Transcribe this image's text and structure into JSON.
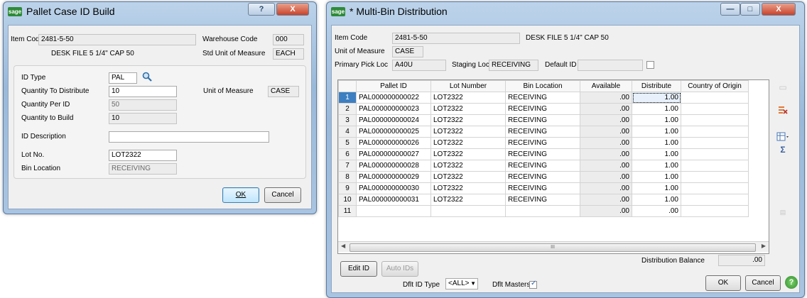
{
  "dialog1": {
    "logo": "sage",
    "title": "Pallet Case ID Build",
    "help_glyph": "?",
    "close_glyph": "X",
    "item_code_label": "Item Code",
    "item_code": "2481-5-50",
    "item_description": "DESK FILE 5 1/4\" CAP 50",
    "warehouse_code_label": "Warehouse Code",
    "warehouse_code": "000",
    "std_uom_label": "Std Unit of Measure",
    "std_uom": "EACH",
    "id_type_label": "ID Type",
    "id_type": "PAL",
    "qty_distribute_label": "Quantity To Distribute",
    "qty_distribute": "10",
    "uom_label": "Unit of Measure",
    "uom": "CASE",
    "qty_per_id_label": "Quantity Per ID",
    "qty_per_id": "50",
    "qty_build_label": "Quantity to Build",
    "qty_build": "10",
    "id_description_label": "ID Description",
    "id_description": "",
    "lot_no_label": "Lot No.",
    "lot_no": "LOT2322",
    "bin_location_label": "Bin Location",
    "bin_location": "RECEIVING",
    "ok_label": "OK",
    "cancel_label": "Cancel"
  },
  "dialog2": {
    "logo": "sage",
    "title": "* Multi-Bin Distribution",
    "min_glyph": "—",
    "max_glyph": "□",
    "close_glyph": "X",
    "item_code_label": "Item Code",
    "item_code": "2481-5-50",
    "item_description": "DESK FILE 5 1/4\" CAP 50",
    "uom_label": "Unit of Measure",
    "uom": "CASE",
    "primary_pick_label": "Primary Pick Loc",
    "primary_pick": "A40U",
    "staging_loc_label": "Staging Loc",
    "staging_loc": "RECEIVING",
    "default_id_label": "Default ID",
    "default_id": "",
    "columns": [
      "",
      "Pallet ID",
      "Lot Number",
      "Bin Location",
      "Available",
      "Distribute",
      "Country of Origin"
    ],
    "rows": [
      {
        "n": "1",
        "pallet": "PAL000000000022",
        "lot": "LOT2322",
        "bin": "RECEIVING",
        "avail": ".00",
        "dist": "1.00"
      },
      {
        "n": "2",
        "pallet": "PAL000000000023",
        "lot": "LOT2322",
        "bin": "RECEIVING",
        "avail": ".00",
        "dist": "1.00"
      },
      {
        "n": "3",
        "pallet": "PAL000000000024",
        "lot": "LOT2322",
        "bin": "RECEIVING",
        "avail": ".00",
        "dist": "1.00"
      },
      {
        "n": "4",
        "pallet": "PAL000000000025",
        "lot": "LOT2322",
        "bin": "RECEIVING",
        "avail": ".00",
        "dist": "1.00"
      },
      {
        "n": "5",
        "pallet": "PAL000000000026",
        "lot": "LOT2322",
        "bin": "RECEIVING",
        "avail": ".00",
        "dist": "1.00"
      },
      {
        "n": "6",
        "pallet": "PAL000000000027",
        "lot": "LOT2322",
        "bin": "RECEIVING",
        "avail": ".00",
        "dist": "1.00"
      },
      {
        "n": "7",
        "pallet": "PAL000000000028",
        "lot": "LOT2322",
        "bin": "RECEIVING",
        "avail": ".00",
        "dist": "1.00"
      },
      {
        "n": "8",
        "pallet": "PAL000000000029",
        "lot": "LOT2322",
        "bin": "RECEIVING",
        "avail": ".00",
        "dist": "1.00"
      },
      {
        "n": "9",
        "pallet": "PAL000000000030",
        "lot": "LOT2322",
        "bin": "RECEIVING",
        "avail": ".00",
        "dist": "1.00"
      },
      {
        "n": "10",
        "pallet": "PAL000000000031",
        "lot": "LOT2322",
        "bin": "RECEIVING",
        "avail": ".00",
        "dist": "1.00"
      },
      {
        "n": "11",
        "pallet": "",
        "lot": "",
        "bin": "",
        "avail": ".00",
        "dist": ".00"
      }
    ],
    "scroll_marker": "III",
    "scroll_left": "◀",
    "scroll_right": "▶",
    "distribution_balance_label": "Distribution Balance",
    "distribution_balance": ".00",
    "edit_id_label": "Edit ID",
    "auto_ids_label": "Auto IDs",
    "dflt_id_type_label": "Dflt ID Type",
    "dflt_id_type": "<ALL>",
    "dflt_masters_label": "Dflt Masters",
    "ok_label": "OK",
    "cancel_label": "Cancel",
    "help_glyph": "?"
  }
}
